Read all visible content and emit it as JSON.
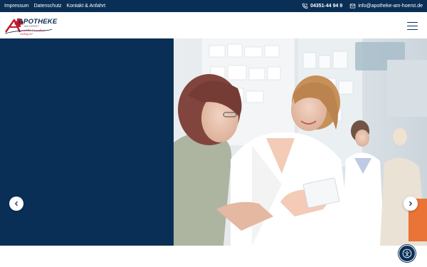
{
  "topbar": {
    "links": [
      "Impressum",
      "Datenschutz",
      "Kontakt & Anfahrt"
    ],
    "phone": "04351-44 94 9",
    "email": "info@apotheke-am-hoerst.de"
  },
  "logo": {
    "wordmark": "APOTHEKE",
    "subline": "AM HÖRST",
    "slogan": "...weil Ihr Gesundheit wichtig ist!"
  },
  "icons": {
    "phone": "phone-icon",
    "email": "envelope-icon",
    "menu": "hamburger-menu-icon",
    "prev": "chevron-left-icon",
    "next": "chevron-right-icon",
    "accessibility": "accessibility-icon"
  },
  "colors": {
    "brand_navy": "#0a2f57",
    "brand_red": "#c0192d",
    "white": "#ffffff"
  },
  "hero": {
    "image": "Pharmacist in white coat showing a medication package to an older customer in a pharmacy"
  }
}
